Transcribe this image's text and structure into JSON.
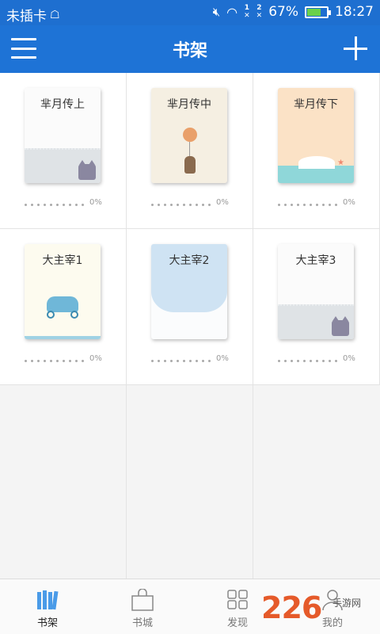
{
  "status_bar": {
    "carrier": "未插卡",
    "sim1": "1",
    "sim2": "2",
    "battery": "67%",
    "battery_level": 0.67,
    "time": "18:27"
  },
  "header": {
    "title": "书架",
    "menu_icon": "hamburger-icon",
    "add_icon": "plus-icon"
  },
  "books": [
    {
      "title": "芈月传上",
      "progress": "0%"
    },
    {
      "title": "芈月传中",
      "progress": "0%"
    },
    {
      "title": "芈月传下",
      "progress": "0%"
    },
    {
      "title": "大主宰1",
      "progress": "0%"
    },
    {
      "title": "大主宰2",
      "progress": "0%"
    },
    {
      "title": "大主宰3",
      "progress": "0%"
    }
  ],
  "bottom_nav": [
    {
      "label": "书架",
      "icon": "bookshelf-icon",
      "active": true
    },
    {
      "label": "书城",
      "icon": "shopping-bag-icon",
      "active": false
    },
    {
      "label": "发现",
      "icon": "grid-icon",
      "active": false
    },
    {
      "label": "我的",
      "icon": "profile-icon",
      "active": false
    }
  ],
  "watermark": {
    "brand": "226",
    "sub": "手游网"
  },
  "colors": {
    "accent": "#1e73d6",
    "status_bar": "#1e6fd0"
  }
}
